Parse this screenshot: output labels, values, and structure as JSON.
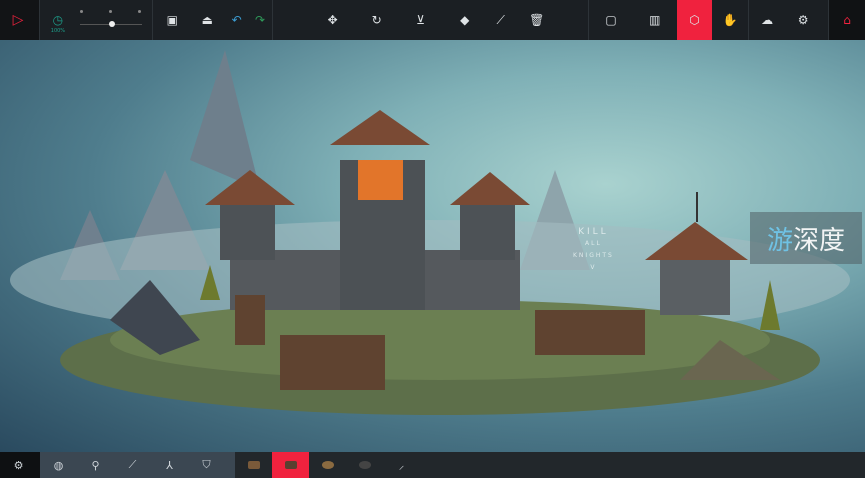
{
  "toolbar": {
    "zoom_label": "100%",
    "left": [
      "play-icon",
      "clock-icon",
      "save-icon",
      "load-icon",
      "undo-icon",
      "redo-icon"
    ],
    "middle": [
      "move-icon",
      "rotate-icon",
      "flip-icon",
      "eraser-icon",
      "wrench-icon",
      "trash-icon"
    ],
    "right": [
      "info-icon",
      "stats-icon",
      "block-cube-icon",
      "hand-icon",
      "cloud-icon",
      "settings-icon",
      "home-icon"
    ]
  },
  "scene": {
    "sign_line1": "KILL",
    "sign_line2": "ALL",
    "sign_line3": "KNIGHTS",
    "sign_line4": "V"
  },
  "watermark": {
    "char1": "游",
    "char2": "深度"
  },
  "bottombar": {
    "categories": [
      "settings-icon",
      "sphere-icon",
      "mechanical-icon",
      "weapon-icon",
      "joint-icon",
      "armor-icon"
    ],
    "blocks": [
      "wooden-block",
      "cannon-block",
      "wheel-block",
      "bomb-block",
      "flag-block"
    ]
  },
  "colors": {
    "accent": "#f0223e",
    "teal": "#1da08c"
  }
}
